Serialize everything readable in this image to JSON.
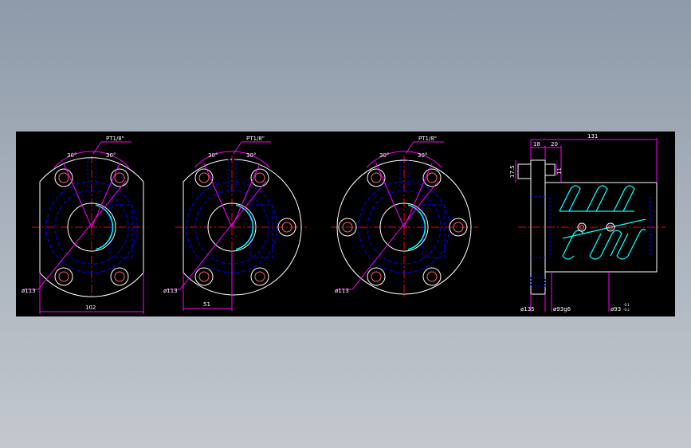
{
  "colors": {
    "background_gradient_top": "#8d9aa9",
    "background_gradient_bottom": "#c3c8ce",
    "drawing_bg": "#000000",
    "outline": "#ffffff",
    "dimension": "#ff00ff",
    "hidden": "#0000ff",
    "center": "#ff0000",
    "bore": "#00ffff",
    "label": "#ffffff"
  },
  "views": {
    "view1": {
      "angle_left": "30°",
      "angle_right": "30°",
      "port_label": "PT1/8\"",
      "pcd_label": "ø113",
      "width_label": "102"
    },
    "view2": {
      "angle_left": "30°",
      "angle_right": "30°",
      "port_label": "PT1/8\"",
      "pcd_label": "ø113",
      "offset_label": "51"
    },
    "view3": {
      "angle_left": "30°",
      "angle_right": "30°",
      "port_label": "PT1/8\"",
      "pcd_label": "ø113"
    },
    "side": {
      "dim_18": "18",
      "dim_20": "20",
      "dim_131": "131",
      "dim_17_5": "17.5",
      "dim_11": "11",
      "flange_dia": "ø135",
      "body_dia": "ø93g6",
      "nut_dia": "ø93"
    }
  }
}
